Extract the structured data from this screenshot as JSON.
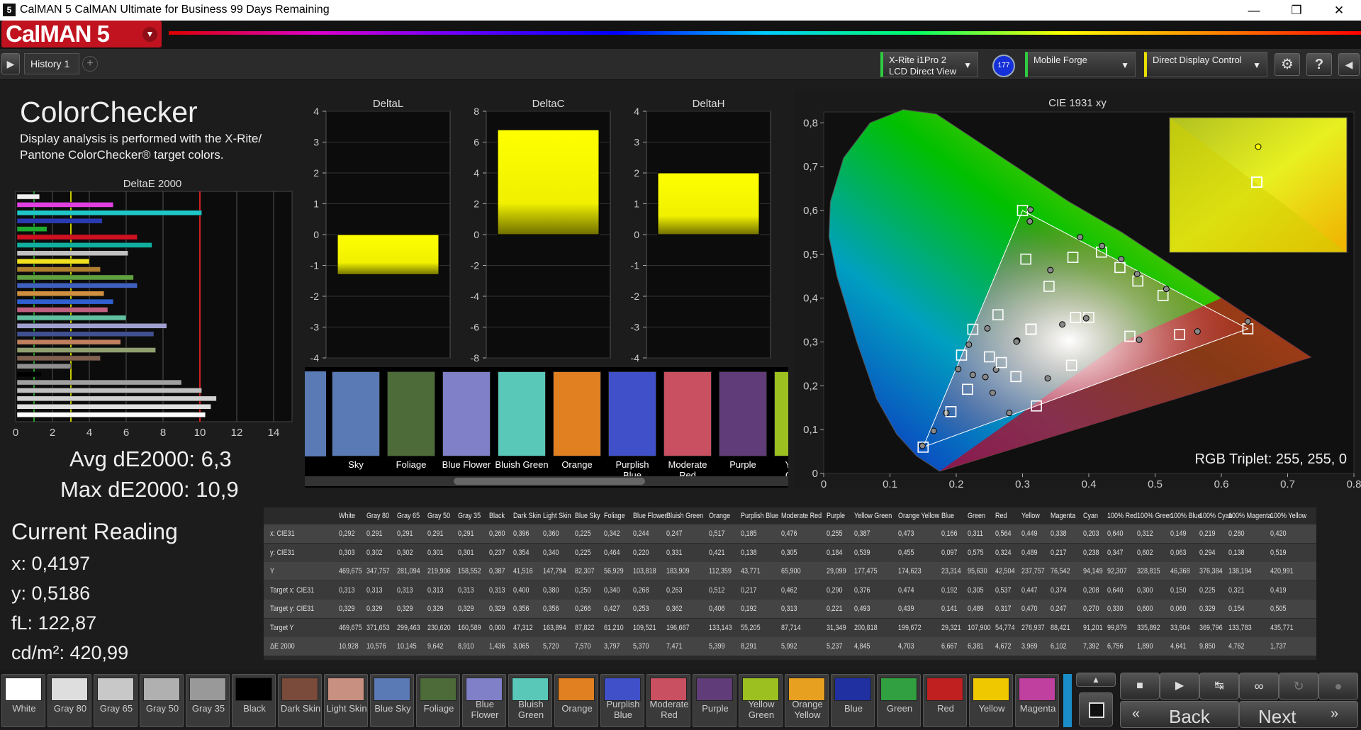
{
  "window": {
    "title": "CalMAN 5 CalMAN Ultimate for Business 99 Days Remaining",
    "icon_text": "5"
  },
  "brand": {
    "logo": "CalMAN 5"
  },
  "toolbar": {
    "tab": "History 1",
    "add": "+",
    "meter_line1": "X-Rite i1Pro 2",
    "meter_line2": "LCD Direct View",
    "badge": "177",
    "source": "Mobile Forge",
    "display": "Direct Display Control",
    "help": "?"
  },
  "left": {
    "title": "ColorChecker",
    "sub1": "Display analysis is performed with the X-Rite/",
    "sub2": "Pantone ColorChecker® target colors.",
    "de_title": "DeltaE 2000",
    "avg": "Avg dE2000: 6,3",
    "max": "Max dE2000: 10,9"
  },
  "reading": {
    "title": "Current Reading",
    "x": "x: 0,4197",
    "y": "y: 0,5186",
    "fl": "fL: 122,87",
    "cd": "cd/m²: 420,99"
  },
  "de_bars": {
    "values": [
      1.3,
      5.3,
      10.1,
      4.7,
      1.7,
      6.6,
      7.4,
      6.1,
      4.0,
      4.6,
      6.4,
      6.6,
      4.8,
      5.3,
      5.0,
      6.0,
      8.2,
      7.5,
      5.7,
      7.6,
      4.6,
      3.0,
      1.4,
      9.0,
      10.1,
      10.9,
      10.6,
      10.3
    ],
    "colors": [
      "#f0f0f0",
      "#e040e0",
      "#1fc8c8",
      "#2a3ab0",
      "#1faa30",
      "#d01020",
      "#10b0a0",
      "#c0c0c0",
      "#f0e020",
      "#b08030",
      "#60a040",
      "#4060c0",
      "#d09040",
      "#3060d0",
      "#c06080",
      "#60c0a0",
      "#a0a0d0",
      "#405090",
      "#c08060",
      "#90a070",
      "#806050",
      "#909090",
      "#000000",
      "#a0a0a0",
      "#c0c0c0",
      "#d0d0d0",
      "#e0e0e0",
      "#ffffff"
    ],
    "ticks": [
      "0",
      "2",
      "4",
      "6",
      "8",
      "10",
      "12",
      "14"
    ]
  },
  "delta": [
    {
      "title": "DeltaL",
      "ticks": [
        "4",
        "3",
        "2",
        "1",
        "0",
        "-1",
        "-2",
        "-3",
        "-4"
      ],
      "value": -1.3,
      "range": [
        -4,
        4
      ]
    },
    {
      "title": "DeltaC",
      "ticks": [
        "8",
        "6",
        "4",
        "2",
        "0",
        "-2",
        "-4",
        "-6",
        "-8"
      ],
      "value": 6.8,
      "range": [
        -8,
        8
      ]
    },
    {
      "title": "DeltaH",
      "ticks": [
        "4",
        "3",
        "2",
        "1",
        "0",
        "-1",
        "-2",
        "-3",
        "-4"
      ],
      "value": 2.0,
      "range": [
        -4,
        4
      ]
    }
  ],
  "swatches": [
    {
      "name": "Sky",
      "color": "#5a7ab5"
    },
    {
      "name": "Foliage",
      "color": "#4d6b38"
    },
    {
      "name": "Blue Flower",
      "color": "#8080c8"
    },
    {
      "name": "Bluish Green",
      "color": "#5ac8b8"
    },
    {
      "name": "Orange",
      "color": "#e08020"
    },
    {
      "name": "Purplish Blue",
      "color": "#4050c8"
    },
    {
      "name": "Moderate Red",
      "color": "#c85060"
    },
    {
      "name": "Purple",
      "color": "#603c78"
    },
    {
      "name": "Yellow Green",
      "color": "#9cc020"
    }
  ],
  "cie": {
    "title": "CIE 1931 xy",
    "xticks": [
      "0",
      "0,1",
      "0,2",
      "0,3",
      "0,4",
      "0,5",
      "0,6",
      "0,7",
      "0,8"
    ],
    "yticks": [
      "0,8",
      "0,7",
      "0,6",
      "0,5",
      "0,4",
      "0,3",
      "0,2",
      "0,1",
      "0"
    ],
    "triplet": "RGB Triplet: 255, 255, 0"
  },
  "table": {
    "headers": [
      "White",
      "Gray 80",
      "Gray 65",
      "Gray 50",
      "Gray 35",
      "Black",
      "Dark Skin",
      "Light Skin",
      "Blue Sky",
      "Foliage",
      "Blue Flower",
      "Bluish Green",
      "Orange",
      "Purplish Blue",
      "Moderate Red",
      "Purple",
      "Yellow Green",
      "Orange Yellow",
      "Blue",
      "Green",
      "Red",
      "Yellow",
      "Magenta",
      "Cyan",
      "100% Red",
      "100% Green",
      "100% Blue",
      "100% Cyan",
      "100% Magenta",
      "100% Yellow"
    ],
    "rows": [
      {
        "label": "x: CIE31",
        "vals": [
          "0,292",
          "0,291",
          "0,291",
          "0,291",
          "0,291",
          "0,260",
          "0,396",
          "0,360",
          "0,225",
          "0,342",
          "0,244",
          "0,247",
          "0,517",
          "0,185",
          "0,476",
          "0,255",
          "0,387",
          "0,473",
          "0,166",
          "0,311",
          "0,564",
          "0,449",
          "0,338",
          "0,203",
          "0,640",
          "0,312",
          "0,149",
          "0,219",
          "0,280",
          "0,420"
        ]
      },
      {
        "label": "y: CIE31",
        "vals": [
          "0,303",
          "0,302",
          "0,302",
          "0,301",
          "0,301",
          "0,237",
          "0,354",
          "0,340",
          "0,225",
          "0,464",
          "0,220",
          "0,331",
          "0,421",
          "0,138",
          "0,305",
          "0,184",
          "0,539",
          "0,455",
          "0,097",
          "0,575",
          "0,324",
          "0,489",
          "0,217",
          "0,238",
          "0,347",
          "0,602",
          "0,063",
          "0,294",
          "0,138",
          "0,519"
        ]
      },
      {
        "label": "Y",
        "vals": [
          "469,675",
          "347,757",
          "281,094",
          "219,906",
          "158,552",
          "0,387",
          "41,516",
          "147,794",
          "82,307",
          "56,929",
          "103,818",
          "183,909",
          "112,359",
          "43,771",
          "65,900",
          "29,099",
          "177,475",
          "174,623",
          "23,314",
          "95,630",
          "42,504",
          "237,757",
          "76,542",
          "94,149",
          "92,307",
          "328,815",
          "46,368",
          "376,384",
          "138,194",
          "420,991"
        ]
      },
      {
        "label": "Target x: CIE31",
        "vals": [
          "0,313",
          "0,313",
          "0,313",
          "0,313",
          "0,313",
          "0,313",
          "0,400",
          "0,380",
          "0,250",
          "0,340",
          "0,268",
          "0,263",
          "0,512",
          "0,217",
          "0,462",
          "0,290",
          "0,376",
          "0,474",
          "0,192",
          "0,305",
          "0,537",
          "0,447",
          "0,374",
          "0,208",
          "0,640",
          "0,300",
          "0,150",
          "0,225",
          "0,321",
          "0,419"
        ]
      },
      {
        "label": "Target y: CIE31",
        "vals": [
          "0,329",
          "0,329",
          "0,329",
          "0,329",
          "0,329",
          "0,329",
          "0,356",
          "0,356",
          "0,266",
          "0,427",
          "0,253",
          "0,362",
          "0,406",
          "0,192",
          "0,313",
          "0,221",
          "0,493",
          "0,439",
          "0,141",
          "0,489",
          "0,317",
          "0,470",
          "0,247",
          "0,270",
          "0,330",
          "0,600",
          "0,060",
          "0,329",
          "0,154",
          "0,505"
        ]
      },
      {
        "label": "Target Y",
        "vals": [
          "469,675",
          "371,653",
          "299,463",
          "230,620",
          "160,589",
          "0,000",
          "47,312",
          "163,894",
          "87,822",
          "61,210",
          "109,521",
          "196,667",
          "133,143",
          "55,205",
          "87,714",
          "31,349",
          "200,818",
          "199,672",
          "29,321",
          "107,900",
          "54,774",
          "276,937",
          "88,421",
          "91,201",
          "99,879",
          "335,892",
          "33,904",
          "369,796",
          "133,783",
          "435,771"
        ]
      },
      {
        "label": "ΔE 2000",
        "vals": [
          "10,928",
          "10,576",
          "10,145",
          "9,642",
          "8,910",
          "1,436",
          "3,065",
          "5,720",
          "7,570",
          "3,797",
          "5,370",
          "7,471",
          "5,399",
          "8,291",
          "5,992",
          "5,237",
          "4,845",
          "4,703",
          "6,667",
          "6,381",
          "4,672",
          "3,969",
          "6,102",
          "7,392",
          "6,756",
          "1,890",
          "4,641",
          "9,850",
          "4,762",
          "1,737"
        ]
      }
    ]
  },
  "bottom": {
    "swatches": [
      {
        "name": "White",
        "color": "#ffffff"
      },
      {
        "name": "Gray 80",
        "color": "#dedede"
      },
      {
        "name": "Gray 65",
        "color": "#c8c8c8"
      },
      {
        "name": "Gray 50",
        "color": "#b0b0b0"
      },
      {
        "name": "Gray 35",
        "color": "#999999"
      },
      {
        "name": "Black",
        "color": "#000000"
      },
      {
        "name": "Dark Skin",
        "color": "#7a4a3a"
      },
      {
        "name": "Light Skin",
        "color": "#c89080"
      },
      {
        "name": "Blue Sky",
        "color": "#5a7ab5"
      },
      {
        "name": "Foliage",
        "color": "#4d6b38"
      },
      {
        "name": "Blue Flower",
        "color": "#8080c8"
      },
      {
        "name": "Bluish Green",
        "color": "#5ac8b8"
      },
      {
        "name": "Orange",
        "color": "#e08020"
      },
      {
        "name": "Purplish Blue",
        "color": "#4050c8"
      },
      {
        "name": "Moderate Red",
        "color": "#c85060"
      },
      {
        "name": "Purple",
        "color": "#603c78"
      },
      {
        "name": "Yellow Green",
        "color": "#9cc020"
      },
      {
        "name": "Orange Yellow",
        "color": "#e8a020"
      },
      {
        "name": "Blue",
        "color": "#2030a0"
      },
      {
        "name": "Green",
        "color": "#30a040"
      },
      {
        "name": "Red",
        "color": "#c02020"
      },
      {
        "name": "Yellow",
        "color": "#f0c800"
      },
      {
        "name": "Magenta",
        "color": "#c040a0"
      }
    ],
    "back": "Back",
    "next": "Next"
  }
}
